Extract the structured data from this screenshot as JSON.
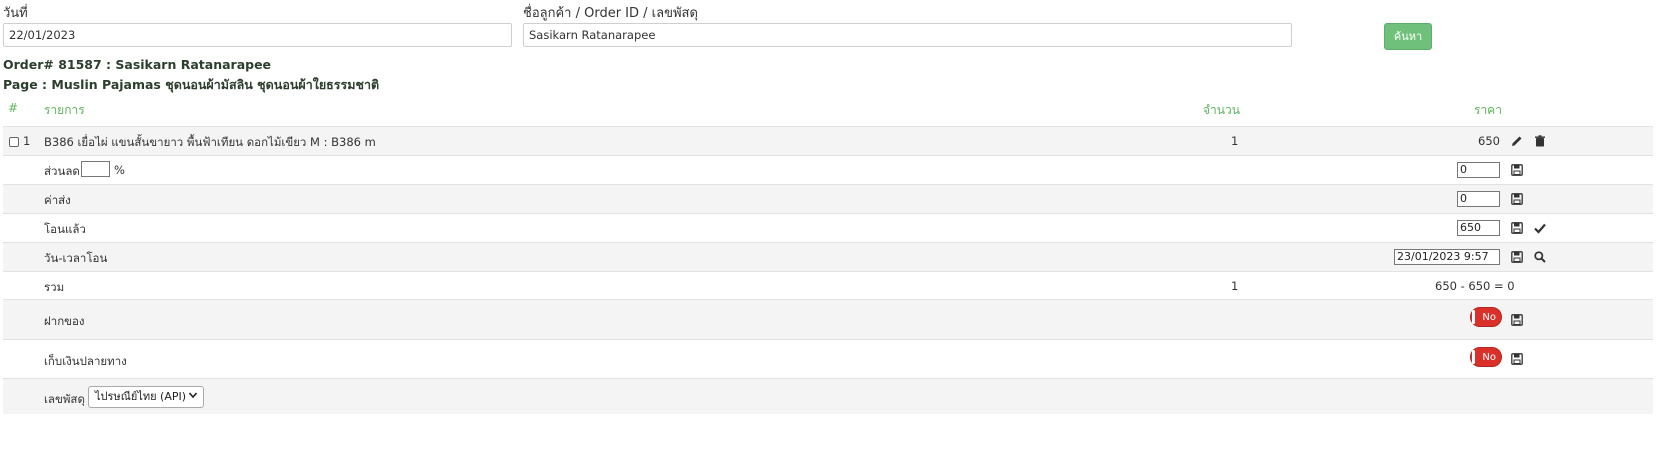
{
  "search": {
    "date_label": "วันที่",
    "date_value": "22/01/2023",
    "customer_label": "ชื่อลูกค้า / Order ID / เลขพัสดุ",
    "customer_value": "Sasikarn Ratanarapee",
    "search_button": "ค้นหา"
  },
  "order": {
    "title": "Order# 81587 : Sasikarn Ratanarapee",
    "page": "Page : Muslin Pajamas ชุดนอนผ้ามัสลิน ชุดนอนผ้าใยธรรมชาติ"
  },
  "table": {
    "headers": {
      "num": "#",
      "item": "รายการ",
      "qty": "จำนวน",
      "price": "ราคา"
    },
    "item": {
      "index": "1",
      "name": "B386 เยื่อไผ่ แขนสั้นขายาว พื้นฟ้าเทียน ดอกไม้เขียว M : B386 m",
      "qty": "1",
      "price": "650"
    },
    "discount": {
      "label": "ส่วนลด",
      "percent_sign": "%",
      "percent_value": "",
      "value": "0"
    },
    "shipping": {
      "label": "ค่าส่ง",
      "value": "0"
    },
    "transferred": {
      "label": "โอนแล้ว",
      "value": "650"
    },
    "transfer_time": {
      "label": "วัน-เวลาโอน",
      "value": "23/01/2023 9:57"
    },
    "total": {
      "label": "รวม",
      "qty": "1",
      "value": "650 - 650 = 0"
    },
    "deposit": {
      "label": "ฝากของ",
      "toggle": "No"
    },
    "cod": {
      "label": "เก็บเงินปลายทาง",
      "toggle": "No"
    },
    "tracking": {
      "label": "เลขพัสดุ",
      "carrier_selected": "ไปรษณีย์ไทย (API)"
    }
  },
  "colors": {
    "accent_green": "#6fc07b",
    "header_green": "#5cb55c",
    "toggle_red": "#d9302a"
  },
  "icons": [
    "pencil-icon",
    "trash-icon",
    "save-icon",
    "check-icon",
    "search-icon",
    "chevron-down-icon"
  ]
}
